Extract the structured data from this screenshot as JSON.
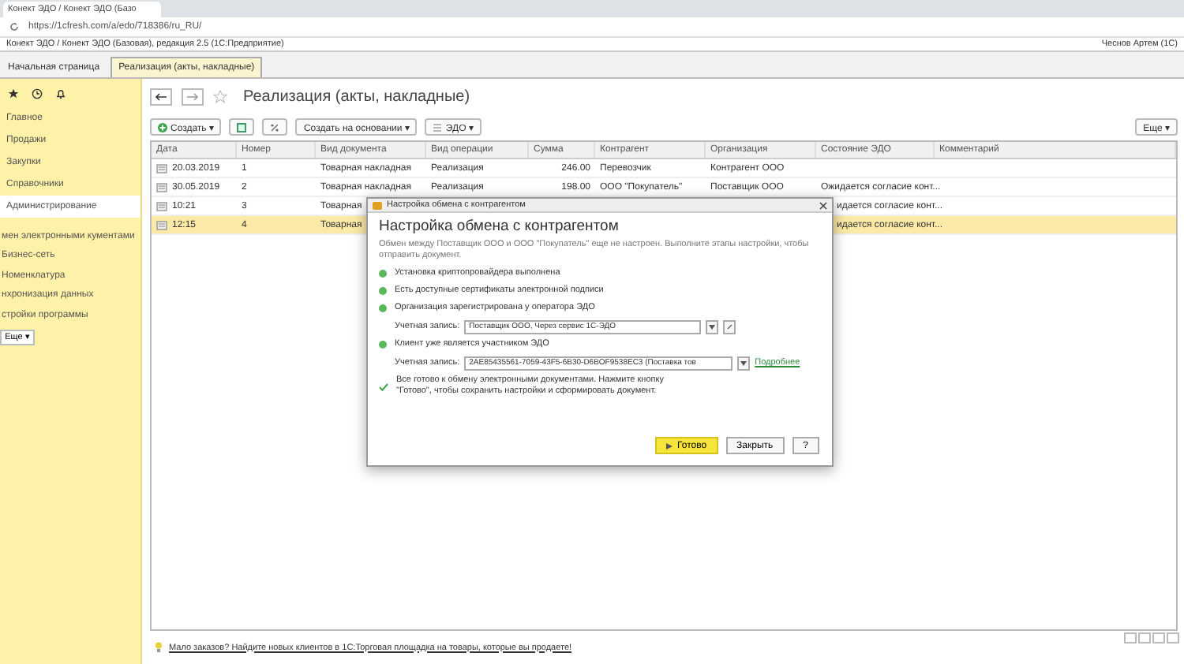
{
  "browser": {
    "tab_title": "Конект ЭДО / Конект ЭДО (Базо",
    "url": "https://1cfresh.com/a/edo/718386/ru_RU/"
  },
  "app": {
    "title": "Конект ЭДО / Конект ЭДО (Базовая), редакция 2.5  (1С:Предприятие)",
    "user": "Чеснов Артем (1С)"
  },
  "tabs": [
    {
      "label": "Начальная страница",
      "selected": false
    },
    {
      "label": "Реализация (акты, накладные)",
      "selected": true
    }
  ],
  "sidebar": {
    "sections": [
      {
        "label": "Главное",
        "selected": false
      },
      {
        "label": "Продажи",
        "selected": false
      },
      {
        "label": "Закупки",
        "selected": false
      },
      {
        "label": "Справочники",
        "selected": false
      },
      {
        "label": "Администрирование",
        "selected": true
      }
    ],
    "links": [
      "мен электронными кументами",
      "Бизнес-сеть",
      "Номенклатура",
      "нхронизация данных",
      "стройки программы"
    ],
    "more": "Еще ▾"
  },
  "content": {
    "title": "Реализация (акты, накладные)",
    "toolbar": {
      "create": "Создать ▾",
      "create_based": "Создать на основании ▾",
      "edo": "ЭДО ▾",
      "more": "Еще ▾"
    },
    "table": {
      "columns": [
        "Дата",
        "Номер",
        "Вид документа",
        "Вид операции",
        "Сумма",
        "Контрагент",
        "Организация",
        "Состояние ЭДО",
        "Комментарий"
      ],
      "rows": [
        {
          "kind": "full",
          "selected": false,
          "cells": [
            "20.03.2019",
            "1",
            "Товарная накладная",
            "Реализация",
            "246.00",
            "Перевозчик",
            "Контрагент ООО"
          ]
        },
        {
          "kind": "full",
          "selected": false,
          "cells": [
            "30.05.2019",
            "2",
            "Товарная накладная",
            "Реализация",
            "198.00",
            "ООО \"Покупатель\"",
            "Поставщик ООО",
            "Ожидается согласие конт..."
          ]
        },
        {
          "kind": "covered",
          "selected": false,
          "cells": [
            "10:21",
            "3",
            "Товарная",
            "идается согласие конт..."
          ]
        },
        {
          "kind": "covered",
          "selected": true,
          "cells": [
            "12:15",
            "4",
            "Товарная",
            "идается согласие конт..."
          ]
        }
      ]
    },
    "promo": "Мало заказов? Найдите новых клиентов в 1С:Торговая площадка на товары, которые вы продаете!"
  },
  "dialog": {
    "window_title": "Настройка обмена с контрагентом",
    "heading": "Настройка обмена с контрагентом",
    "intro": "Обмен между Поставщик ООО и ООО \"Покупатель\" еще не настроен. Выполните этапы настройки, чтобы отправить документ.",
    "steps": [
      {
        "kind": "status",
        "text": "Установка криптопровайдера выполнена"
      },
      {
        "kind": "status",
        "text": "Есть доступные сертификаты электронной подписи"
      },
      {
        "kind": "status",
        "text": "Организация зарегистрирована у оператора ЭДО"
      },
      {
        "kind": "field",
        "label": "Учетная запись:",
        "value": "Поставщик ООО, Через сервис 1С-ЭДО"
      },
      {
        "kind": "status",
        "text": "Клиент уже является участником ЭДО"
      },
      {
        "kind": "field",
        "label": "Учетная запись:",
        "value": "2AE85435561-7059-43F5-6B30-D6BOF9538EC3 (Поставка тов",
        "link": "Подробнее"
      },
      {
        "kind": "done",
        "text": "Все готово к обмену электронными документами. Нажмите кнопку \"Готово\", чтобы сохранить настройки и сформировать документ."
      }
    ],
    "buttons": {
      "ok": "Готово",
      "close": "Закрыть",
      "help": "?"
    }
  }
}
